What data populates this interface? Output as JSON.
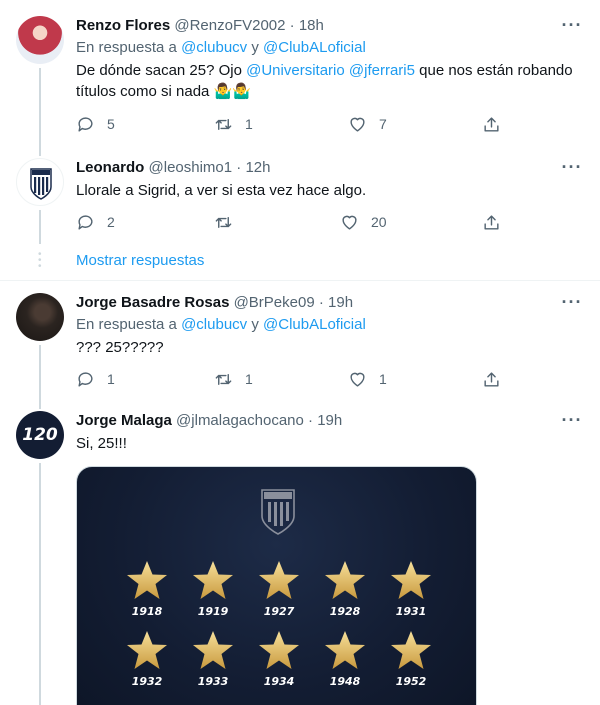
{
  "tweets": [
    {
      "name": "Renzo Flores",
      "handle": "@RenzoFV2002",
      "dot": "·",
      "time": "18h",
      "reply_prefix": "En respuesta a",
      "reply_user1": "@clubucv",
      "reply_and": "y",
      "reply_user2": "@ClubALoficial",
      "text_line1_prefix": "De dónde sacan 25? Ojo",
      "mention1": "@Universitario",
      "mention2": "@jferrari5",
      "text_line1_suffix": "que nos están robando",
      "text_line2": "títulos como si nada 🤷‍♂️🤷‍♂️",
      "replies": "5",
      "retweets": "1",
      "likes": "7",
      "avatar_color": "#b23a48"
    },
    {
      "name": "Leonardo",
      "handle": "@leoshimo1",
      "dot": "·",
      "time": "12h",
      "text": "Llorale a Sigrid, a ver si esta vez hace algo.",
      "replies": "2",
      "retweets": "",
      "likes": "20"
    },
    {
      "name": "Jorge Basadre Rosas",
      "handle": "@BrPeke09",
      "dot": "·",
      "time": "19h",
      "reply_prefix": "En respuesta a",
      "reply_user1": "@clubucv",
      "reply_and": "y",
      "reply_user2": "@ClubALoficial",
      "text": "??? 25?????",
      "replies": "1",
      "retweets": "1",
      "likes": "1"
    },
    {
      "name": "Jorge Malaga",
      "handle": "@jlmalagachocano",
      "dot": "·",
      "time": "19h",
      "text": "Si, 25!!!",
      "avatar_text": "120",
      "media_years": [
        "1918",
        "1919",
        "1927",
        "1928",
        "1931",
        "1932",
        "1933",
        "1934",
        "1948",
        "1952"
      ]
    }
  ],
  "show_replies": "Mostrar respuestas",
  "more_label": "···",
  "colors": {
    "accent": "#1d9bf0",
    "muted": "#536471",
    "gold": "#e8c36a",
    "navy": "#131d33"
  },
  "icons": [
    "reply-icon",
    "retweet-icon",
    "like-icon",
    "share-icon",
    "more-icon"
  ]
}
